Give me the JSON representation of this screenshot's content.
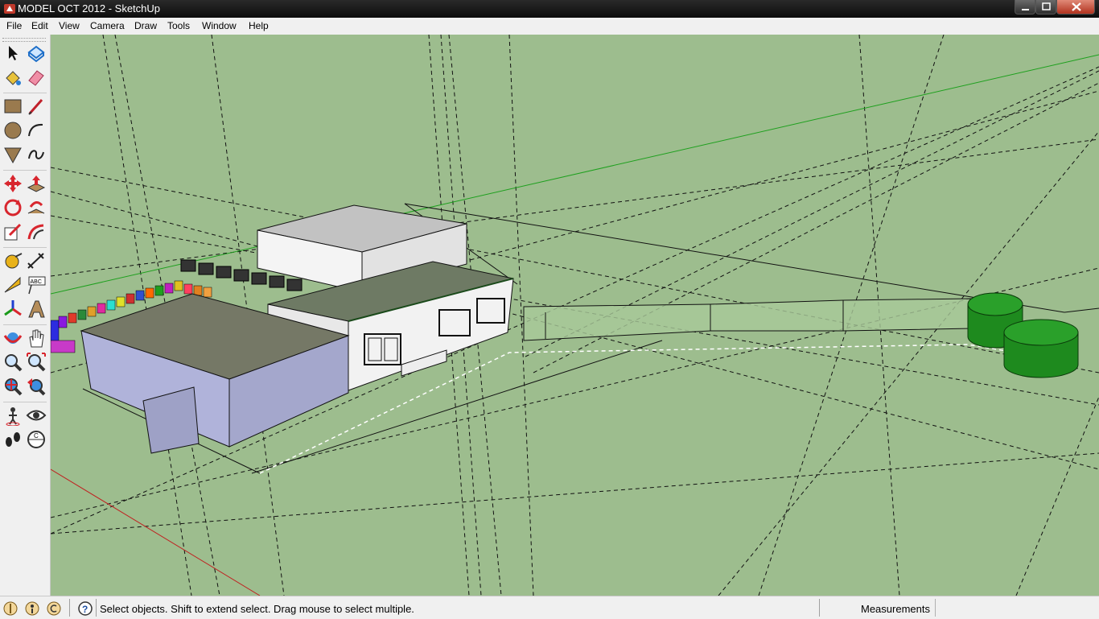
{
  "window": {
    "title": "MODEL OCT 2012 - SketchUp",
    "accent_color": "#b1321e"
  },
  "menu": {
    "items": [
      "File",
      "Edit",
      "View",
      "Camera",
      "Draw",
      "Tools",
      "Window",
      "Help"
    ]
  },
  "toolbar": {
    "tools": [
      {
        "name": "select-icon"
      },
      {
        "name": "make-component-icon"
      },
      {
        "name": "paint-bucket-icon"
      },
      {
        "name": "eraser-icon"
      },
      {
        "name": "rectangle-icon"
      },
      {
        "name": "line-icon"
      },
      {
        "name": "circle-icon"
      },
      {
        "name": "arc-icon"
      },
      {
        "name": "polygon-icon"
      },
      {
        "name": "freehand-icon"
      },
      {
        "name": "move-icon"
      },
      {
        "name": "push-pull-icon"
      },
      {
        "name": "rotate-icon"
      },
      {
        "name": "follow-me-icon"
      },
      {
        "name": "scale-icon"
      },
      {
        "name": "offset-icon"
      },
      {
        "name": "tape-measure-icon"
      },
      {
        "name": "dimension-icon"
      },
      {
        "name": "protractor-icon"
      },
      {
        "name": "text-icon"
      },
      {
        "name": "axes-icon"
      },
      {
        "name": "3d-text-icon"
      },
      {
        "name": "orbit-icon"
      },
      {
        "name": "pan-icon"
      },
      {
        "name": "zoom-icon"
      },
      {
        "name": "zoom-window-icon"
      },
      {
        "name": "zoom-extents-icon"
      },
      {
        "name": "previous-view-icon"
      },
      {
        "name": "position-camera-icon"
      },
      {
        "name": "look-around-icon"
      },
      {
        "name": "walk-icon"
      },
      {
        "name": "section-plane-icon"
      }
    ],
    "text_tool_label": "ABC",
    "section_tool_label": "C"
  },
  "viewport": {
    "background_color": "#9dbd8e",
    "tank_color": "#1e8a1e"
  },
  "status": {
    "message": "Select objects. Shift to extend select. Drag mouse to select multiple.",
    "measurements_label": "Measurements",
    "measurements_value": "",
    "icons": [
      "geo-location-icon",
      "credits-icon",
      "copyright-icon",
      "help-icon"
    ]
  }
}
